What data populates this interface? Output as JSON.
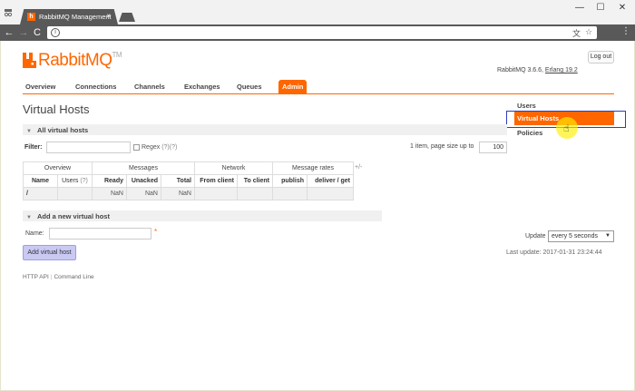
{
  "browser": {
    "tab_title": "RabbitMQ Management",
    "tab_close": "×",
    "tab_favicon": "h",
    "window_controls": [
      "—",
      "☐",
      "✕"
    ],
    "nav_icons": [
      "back-arrow-icon",
      "forward-arrow-icon",
      "reload-icon"
    ],
    "nav_glyphs": [
      "←",
      "→",
      "C"
    ],
    "info_glyph": "i",
    "omnibox_right": [
      "translate-icon",
      "star-icon"
    ],
    "menu_glyph": "⋮"
  },
  "header": {
    "logo_text": "RabbitMQ",
    "logo_tm": "TM",
    "logout_label": "Log out",
    "version_prefix": "RabbitMQ 3.6.6, ",
    "version_erlang": "Erlang 19.2"
  },
  "nav": {
    "items": [
      "Overview",
      "Connections",
      "Channels",
      "Exchanges",
      "Queues",
      "Admin"
    ],
    "active": "Admin"
  },
  "page": {
    "title": "Virtual Hosts"
  },
  "sidebar": {
    "items": [
      "Users",
      "Virtual Hosts",
      "Policies"
    ],
    "active": "Virtual Hosts"
  },
  "all_vhosts": {
    "section_title": "All virtual hosts",
    "filter_label": "Filter:",
    "filter_value": "",
    "regex_label": "Regex",
    "regex_help": "(?)(?)",
    "items_text": "1 item, page size up to",
    "page_size": "100",
    "plus_minus": "+/-",
    "table": {
      "groups": [
        "Overview",
        "Messages",
        "Network",
        "Message rates"
      ],
      "columns": [
        "Name",
        "Users",
        "(?)",
        "Ready",
        "Unacked",
        "Total",
        "From client",
        "To client",
        "publish",
        "deliver / get"
      ],
      "rows": [
        {
          "name": "/",
          "users": "",
          "ready": "NaN",
          "unacked": "NaN",
          "total": "NaN",
          "from_client": "",
          "to_client": "",
          "publish": "",
          "deliver_get": ""
        }
      ]
    }
  },
  "add_vhost": {
    "section_title": "Add a new virtual host",
    "name_label": "Name:",
    "name_value": "",
    "required_mark": "*",
    "button_label": "Add virtual host"
  },
  "refresh": {
    "update_label": "Update",
    "selected": "every 5 seconds",
    "last_update": "Last update: 2017-01-31 23:24:44"
  },
  "footer": {
    "links": [
      "HTTP API",
      "Command Line"
    ]
  },
  "colors": {
    "brand": "#ff6600",
    "chrome_dark": "#595959",
    "button_bg": "#c9c9f4",
    "highlight_border": "#2f3db8"
  }
}
